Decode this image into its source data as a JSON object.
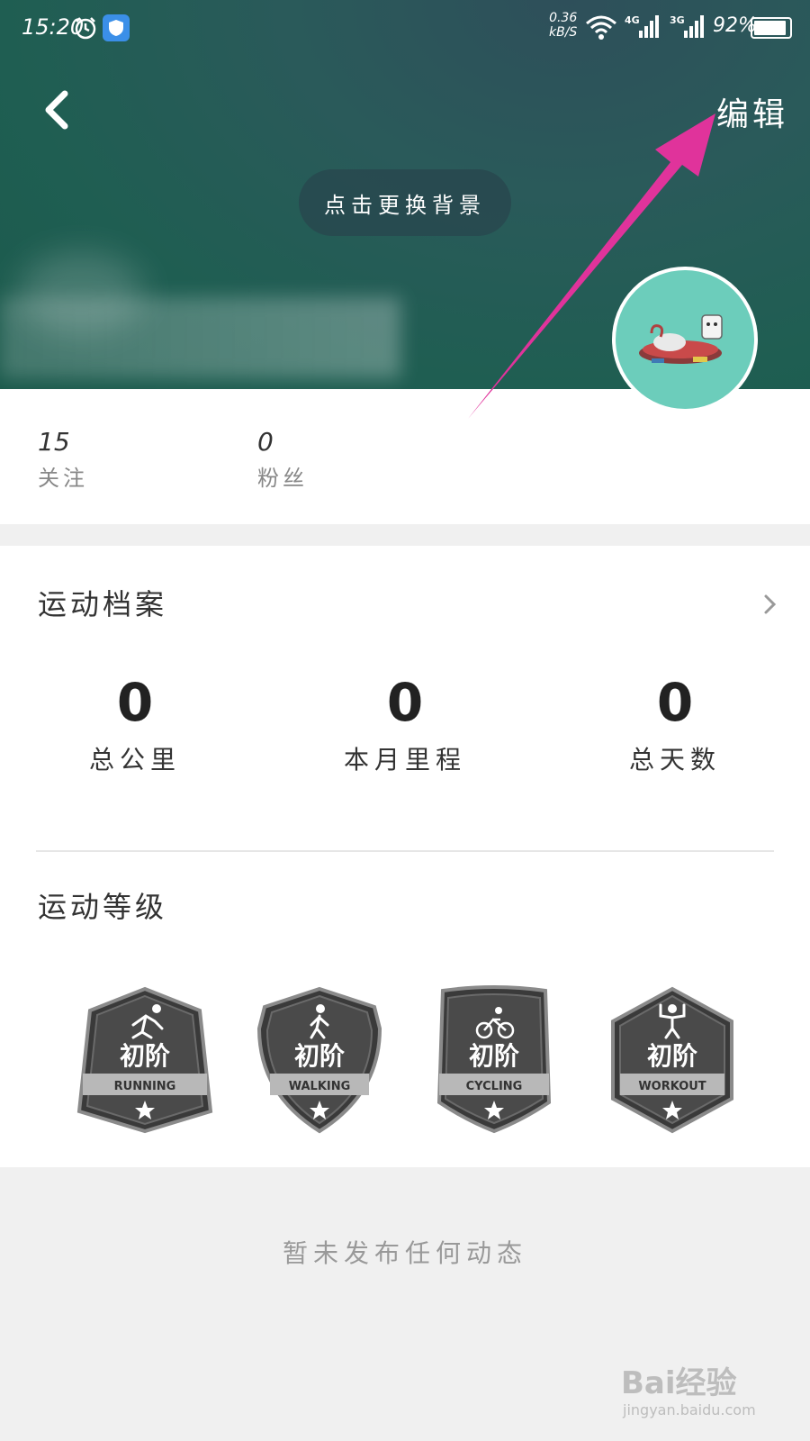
{
  "status_bar": {
    "time": "15:20",
    "net_speed_value": "0.36",
    "net_speed_unit": "kB/S",
    "signal1_type": "4G",
    "signal2_type": "3G",
    "battery": "92%"
  },
  "header": {
    "edit_label": "编辑",
    "change_background_label": "点击更换背景"
  },
  "social": {
    "following_count": "15",
    "following_label": "关注",
    "followers_count": "0",
    "followers_label": "粉丝"
  },
  "profile": {
    "title": "运动档案",
    "metrics": [
      {
        "value": "0",
        "label": "总公里"
      },
      {
        "value": "0",
        "label": "本月里程"
      },
      {
        "value": "0",
        "label": "总天数"
      }
    ]
  },
  "levels": {
    "title": "运动等级",
    "badges": [
      {
        "level": "初阶",
        "name": "RUNNING",
        "icon": "running-icon"
      },
      {
        "level": "初阶",
        "name": "WALKING",
        "icon": "walking-icon"
      },
      {
        "level": "初阶",
        "name": "CYCLING",
        "icon": "cycling-icon"
      },
      {
        "level": "初阶",
        "name": "WORKOUT",
        "icon": "workout-icon"
      }
    ]
  },
  "feed": {
    "empty_message": "暂未发布任何动态"
  },
  "watermark": {
    "brand": "Bai经验",
    "url": "jingyan.baidu.com"
  },
  "colors": {
    "header_bg": "#1f5e52",
    "avatar_bg": "#6ccdbb",
    "annotation_arrow": "#e0339b",
    "badge_fill": "#4a4a4a"
  }
}
